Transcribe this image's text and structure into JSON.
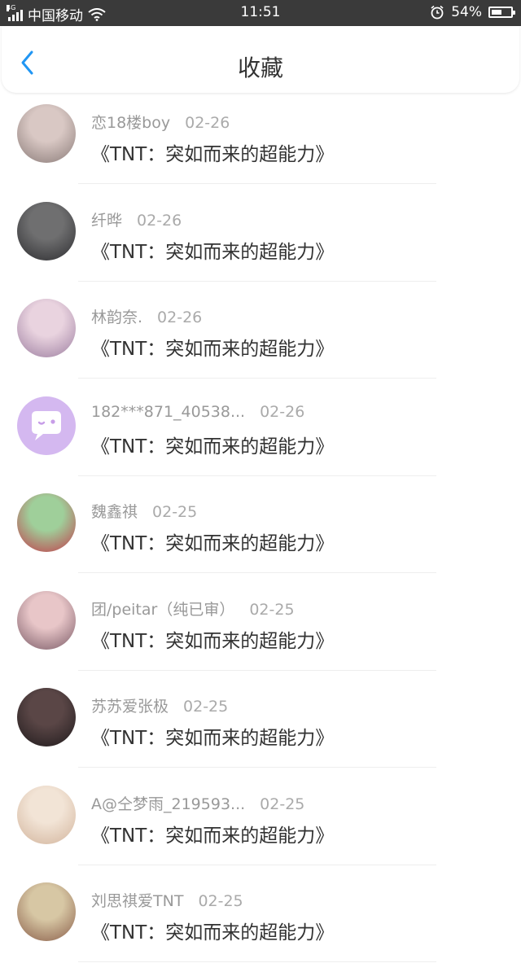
{
  "status_bar": {
    "network": "4G",
    "carrier": "中国移动",
    "time": "11:51",
    "battery": "54%",
    "battery_level": 0.54
  },
  "header": {
    "title": "收藏"
  },
  "favorites": [
    {
      "user": "恋18楼boy",
      "date": "02-26",
      "title": "《TNT：突如而来的超能力》"
    },
    {
      "user": "纤晔",
      "date": "02-26",
      "title": "《TNT：突如而来的超能力》"
    },
    {
      "user": "林韵奈.",
      "date": "02-26",
      "title": "《TNT：突如而来的超能力》"
    },
    {
      "user": "182***871_40538...",
      "date": "02-26",
      "title": "《TNT：突如而来的超能力》"
    },
    {
      "user": "魏鑫祺",
      "date": "02-25",
      "title": "《TNT：突如而来的超能力》"
    },
    {
      "user": "团/peitar（纯已审）",
      "date": "02-25",
      "title": "《TNT：突如而来的超能力》"
    },
    {
      "user": "苏苏爱张极",
      "date": "02-25",
      "title": "《TNT：突如而来的超能力》"
    },
    {
      "user": "A@仝梦雨_219593...",
      "date": "02-25",
      "title": "《TNT：突如而来的超能力》"
    },
    {
      "user": "刘思祺爱TNT",
      "date": "02-25",
      "title": "《TNT：突如而来的超能力》"
    }
  ],
  "colors": {
    "status_bar_bg": "#3a3a3a",
    "accent_back": "#2196f3",
    "title_text": "#333333",
    "meta_text": "#999999"
  }
}
